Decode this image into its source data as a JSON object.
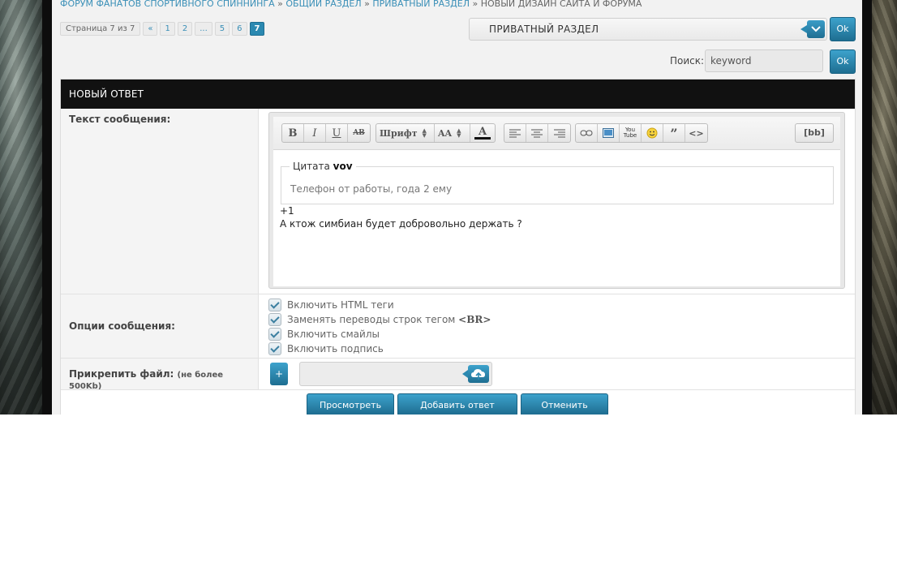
{
  "breadcrumb": {
    "items": [
      "ФОРУМ ФАНАТОВ СПОРТИВНОГО СПИННИНГА",
      "ОБЩИЙ РАЗДЕЛ",
      "ПРИВАТНЫЙ РАЗДЕЛ"
    ],
    "current": "НОВЫЙ ДИЗАЙН САЙТА И ФОРУМА",
    "separator": "»"
  },
  "pagination": {
    "info": "Страница 7 из 7",
    "prev": "«",
    "pages": [
      "1",
      "2",
      "...",
      "5",
      "6"
    ],
    "current": "7"
  },
  "forum_jump": {
    "selected": "ПРИВАТНЫЙ РАЗДЕЛ",
    "ok_label": "Ok"
  },
  "search": {
    "label": "Поиск:",
    "value": "keyword",
    "ok_label": "Ok"
  },
  "form": {
    "title": "НОВЫЙ ОТВЕТ",
    "message_label": "Текст сообщения:",
    "toolbar": {
      "bold": "B",
      "italic": "I",
      "underline": "U",
      "strike": "AB",
      "font": "Шрифт",
      "size": "AA",
      "color": "A",
      "youtube": "You Tube",
      "quote": "”",
      "code": "<>",
      "bbcode": "[bb]"
    },
    "editor": {
      "quote_prefix": "Цитата",
      "quote_author": "vov",
      "quote_text": "Телефон от работы, года 2 ему",
      "line1": "+1",
      "line2": "А ктож симбиан будет добровольно держать ?"
    },
    "options_label": "Опции сообщения:",
    "options": [
      "Включить HTML теги",
      "Заменять переводы строк тегом",
      "Включить смайлы",
      "Включить подпись"
    ],
    "br_tag": "<BR>",
    "attach_label": "Прикрепить файл:",
    "attach_note": "(не более 500Kb)",
    "attach_plus": "+",
    "buttons": {
      "preview": "Просмотреть",
      "submit": "Добавить ответ",
      "cancel": "Отменить"
    }
  },
  "colors": {
    "accent": "#2b89b1",
    "header_bg": "#111111",
    "link": "#3a8fb7"
  }
}
